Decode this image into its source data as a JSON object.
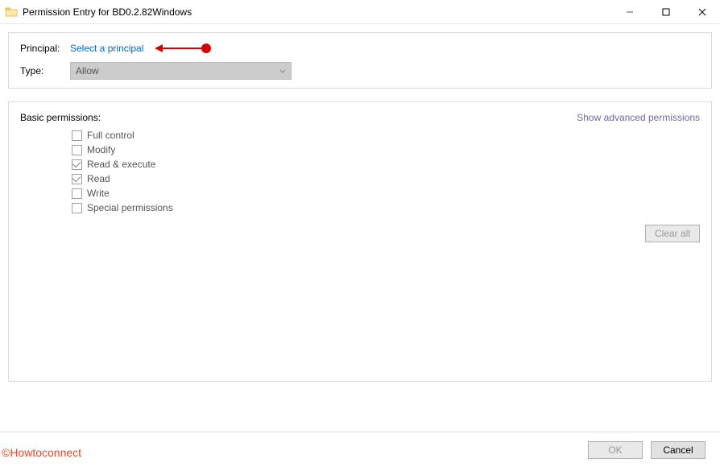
{
  "window": {
    "title": "Permission Entry for BD0.2.82Windows"
  },
  "top": {
    "principal_label": "Principal:",
    "principal_link": "Select a principal",
    "type_label": "Type:",
    "type_value": "Allow"
  },
  "permissions": {
    "header": "Basic permissions:",
    "advanced_link": "Show advanced permissions",
    "items": [
      {
        "label": "Full control",
        "checked": false
      },
      {
        "label": "Modify",
        "checked": false
      },
      {
        "label": "Read & execute",
        "checked": true
      },
      {
        "label": "Read",
        "checked": true
      },
      {
        "label": "Write",
        "checked": false
      },
      {
        "label": "Special permissions",
        "checked": false
      }
    ],
    "clear_all": "Clear all"
  },
  "footer": {
    "ok": "OK",
    "cancel": "Cancel"
  },
  "watermark": "©Howtoconnect"
}
